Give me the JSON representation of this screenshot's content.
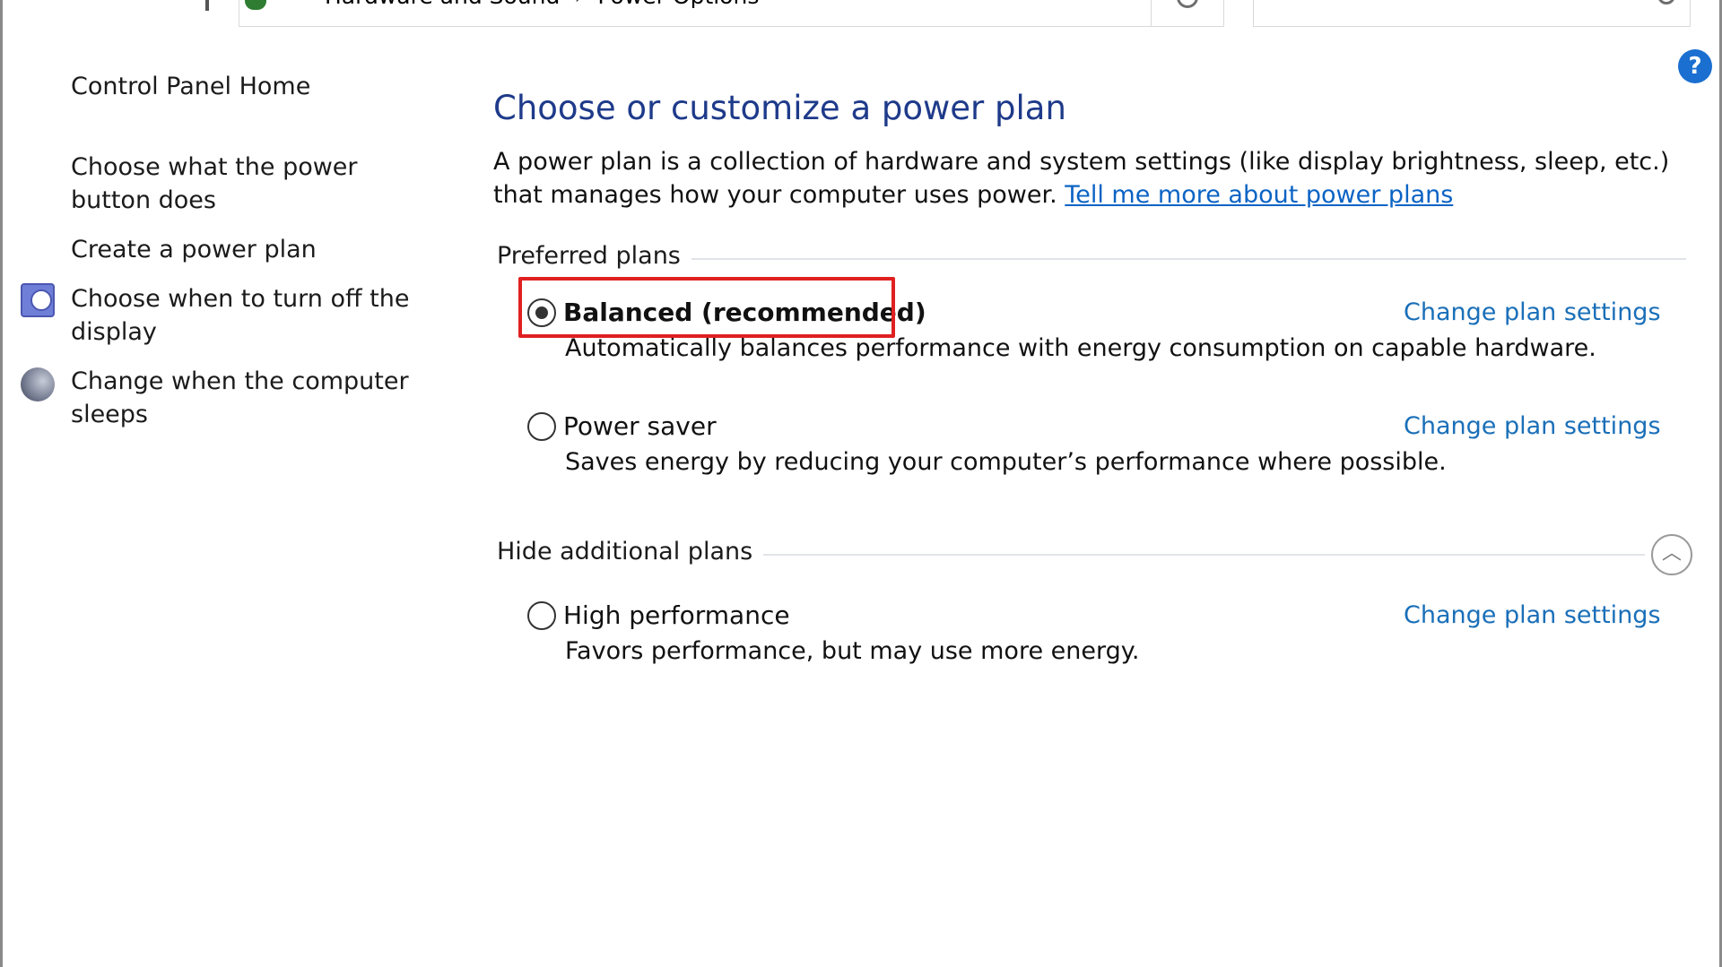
{
  "address_bar": {
    "back_icon": "back-arrow-icon",
    "forward_icon": "forward-arrow-icon",
    "breadcrumb": [
      "Hardware and Sound",
      "Power Options"
    ],
    "breadcrumb_separator": "›"
  },
  "help": {
    "label": "?"
  },
  "sidebar": {
    "home_link": "Control Panel Home",
    "items": [
      {
        "label": "Choose what the power button does",
        "icon": null
      },
      {
        "label": "Create a power plan",
        "icon": null
      },
      {
        "label": "Choose when to turn off the display",
        "icon": "display-clock-icon"
      },
      {
        "label": "Change when the computer sleeps",
        "icon": "sleep-moon-icon"
      }
    ]
  },
  "main": {
    "title": "Choose or customize a power plan",
    "intro_text": "A power plan is a collection of hardware and system settings (like display brightness, sleep, etc.) that manages how your computer uses power. ",
    "intro_link": "Tell me more about power plans",
    "preferred_group_label": "Preferred plans",
    "additional_group_label": "Hide additional plans",
    "plans": [
      {
        "name": "Balanced (recommended)",
        "description": "Automatically balances performance with energy consumption on capable hardware.",
        "change_link": "Change plan settings",
        "selected": true
      },
      {
        "name": "Power saver",
        "description": "Saves energy by reducing your computer’s performance where possible.",
        "change_link": "Change plan settings",
        "selected": false
      },
      {
        "name": "High performance",
        "description": "Favors performance, but may use more energy.",
        "change_link": "Change plan settings",
        "selected": false
      }
    ]
  },
  "colors": {
    "title": "#1e3a8a",
    "link": "#1a6fb8",
    "highlight": "#e02020",
    "help": "#1a6fd0"
  }
}
